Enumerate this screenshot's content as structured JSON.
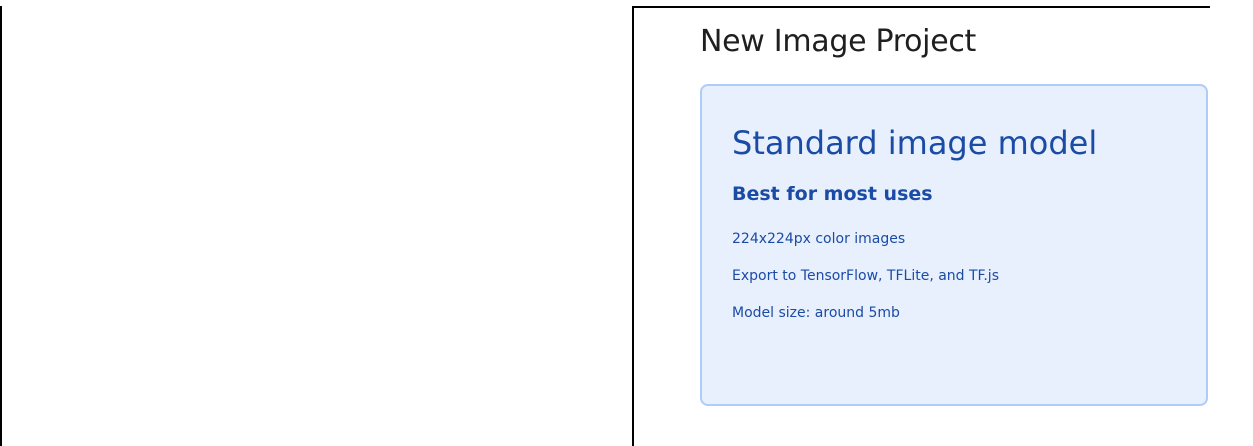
{
  "page": {
    "title": "New Image Project"
  },
  "card": {
    "title": "Standard image model",
    "subtitle": "Best for most uses",
    "details": [
      "224x224px color images",
      "Export to TensorFlow, TFLite, and TF.js",
      "Model size: around 5mb"
    ]
  },
  "colors": {
    "card_background": "#e8f0fe",
    "card_border": "#aecbfa",
    "card_text": "#1a4ba5",
    "title_text": "#1f1f1f"
  }
}
